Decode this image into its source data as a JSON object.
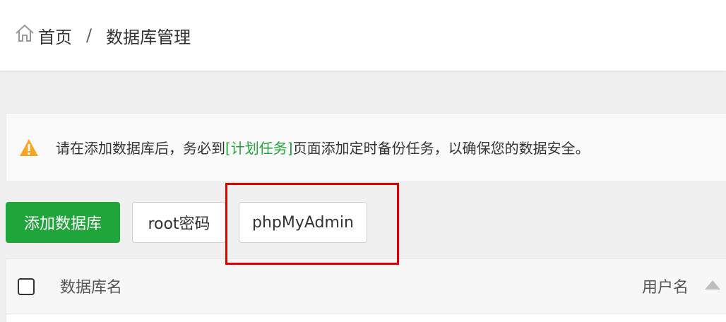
{
  "breadcrumb": {
    "home_label": "首页",
    "separator": "/",
    "current": "数据库管理"
  },
  "alert": {
    "text_before": "请在添加数据库后，务必到",
    "link_text": "[计划任务]",
    "text_after": "页面添加定时备份任务，以确保您的数据安全。"
  },
  "toolbar": {
    "add_db_label": "添加数据库",
    "root_password_label": "root密码",
    "phpmyadmin_label": "phpMyAdmin"
  },
  "table": {
    "columns": [
      "数据库名",
      "用户名"
    ]
  },
  "colors": {
    "accent": "#20a53a",
    "highlight": "#e00000",
    "warning": "#f5a623"
  },
  "icons": {
    "home": "home-icon",
    "warning": "warning-icon",
    "sort": "sort-ascending-icon"
  }
}
